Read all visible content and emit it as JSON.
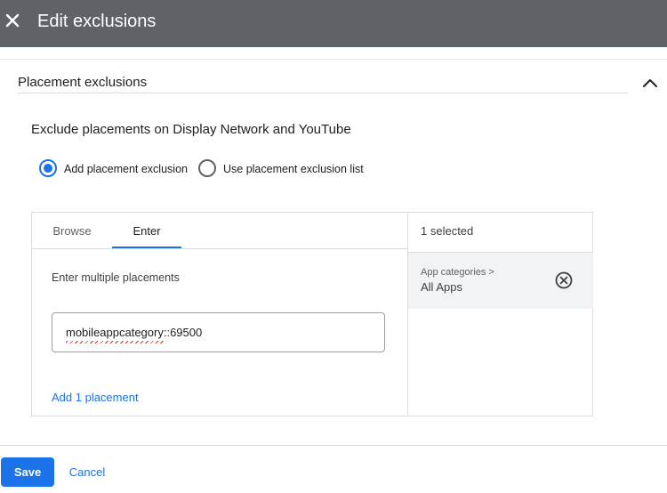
{
  "header": {
    "title": "Edit exclusions",
    "close_icon": "close-icon"
  },
  "section": {
    "title": "Placement exclusions",
    "collapse_icon": "chevron-up-icon"
  },
  "subtitle": "Exclude placements on Display Network and YouTube",
  "radio_options": [
    {
      "label": "Add placement exclusion",
      "checked": true
    },
    {
      "label": "Use placement exclusion list",
      "checked": false
    }
  ],
  "tabs": [
    {
      "label": "Browse",
      "active": false
    },
    {
      "label": "Enter",
      "active": true
    }
  ],
  "enter_pane": {
    "label": "Enter multiple placements",
    "input_value": "mobileappcategory::69500",
    "add_link": "Add 1 placement"
  },
  "selected_pane": {
    "count_label": "1 selected",
    "items": [
      {
        "category": "App categories >",
        "name": "All Apps",
        "remove_icon": "remove-circle-icon"
      }
    ]
  },
  "footer": {
    "save_label": "Save",
    "cancel_label": "Cancel"
  },
  "colors": {
    "header_bg": "#5f6368",
    "accent": "#1a73e8",
    "selected_item_bg": "#f1f3f4"
  }
}
